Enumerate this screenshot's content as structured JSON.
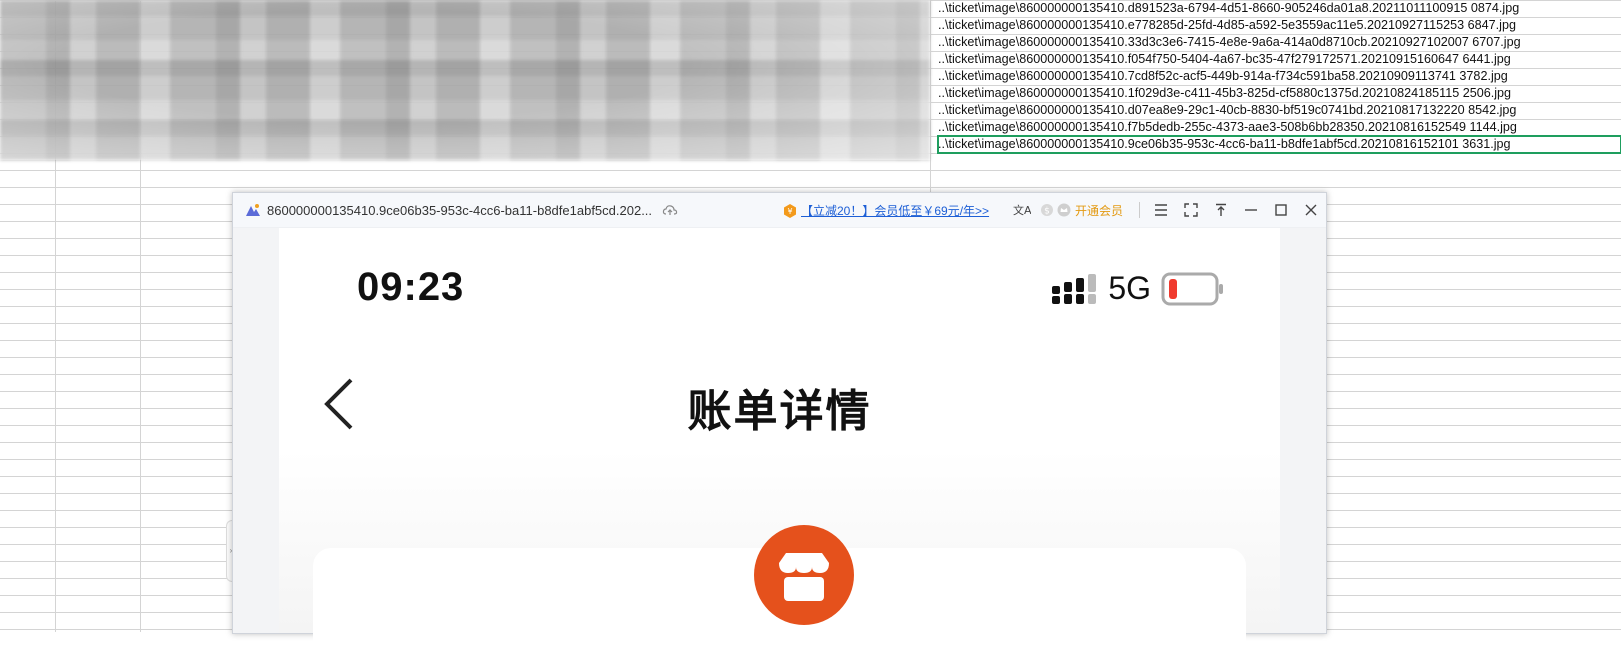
{
  "spreadsheet": {
    "rows": [
      "..\\ticket\\image\\860000000135410.d891523a-6794-4d51-8660-905246da01a8.20211011100915 0874.jpg",
      "..\\ticket\\image\\860000000135410.e778285d-25fd-4d85-a592-5e3559ac11e5.20210927115253 6847.jpg"
    ],
    "paths": [
      "..\\ticket\\image\\860000000135410.d891523a-6794-4d51-8660-905246da01a8.20211011100915 0874.jpg",
      "..\\ticket\\image\\860000000135410.e778285d-25fd-4d85-a592-5e3559ac11e5.20210927115253 6847.jpg",
      "..\\ticket\\image\\860000000135410.33d3c3e6-7415-4e8e-9a6a-414a0d8710cb.20210927102007 6707.jpg",
      "..\\ticket\\image\\860000000135410.f054f750-5404-4a67-bc35-47f279172571.20210915160647 6441.jpg",
      "..\\ticket\\image\\860000000135410.7cd8f52c-acf5-449b-914a-f734c591ba58.20210909113741 3782.jpg",
      "..\\ticket\\image\\860000000135410.1f029d3e-c411-45b3-825d-cf5880c1375d.20210824185115 2506.jpg",
      "..\\ticket\\image\\860000000135410.d07ea8e9-29c1-40cb-8830-bf519c0741bd.20210817132220 8542.jpg",
      "..\\ticket\\image\\860000000135410.f7b5dedb-255c-4373-aae3-508b6bb28350.20210816152549 1144.jpg",
      "..\\ticket\\image\\860000000135410.9ce06b35-953c-4cc6-ba11-b8dfe1abf5cd.20210816152101 3631.jpg"
    ]
  },
  "viewer": {
    "title": "860000000135410.9ce06b35-953c-4cc6-ba11-b8dfe1abf5cd.202...",
    "promo": "【立减20！】会员低至￥69元/年>>",
    "vip_label": "开通会员"
  },
  "phone": {
    "time": "09:23",
    "network": "5G",
    "page_title": "账单详情"
  },
  "colors": {
    "accent_green": "#1e9e5e",
    "shop_orange": "#e5511c",
    "battery_red": "#f03a2e",
    "link_blue": "#1d5fd6"
  }
}
